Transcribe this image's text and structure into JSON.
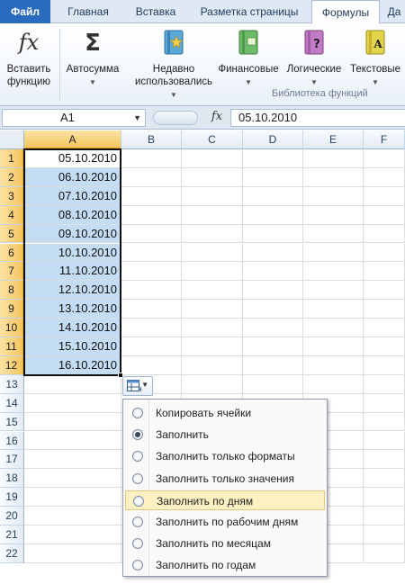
{
  "ribbon_tabs": [
    "Файл",
    "Главная",
    "Вставка",
    "Разметка страницы",
    "Формулы",
    "Да"
  ],
  "active_tab": "Формулы",
  "ribbon": {
    "insert_function": {
      "line1": "Вставить",
      "line2": "функцию",
      "icon": "fx"
    },
    "autosum": {
      "label": "Автосумма",
      "icon": "Σ"
    },
    "recent": {
      "line1": "Недавно",
      "line2": "использовались"
    },
    "financial": {
      "label": "Финансовые"
    },
    "logical": {
      "label": "Логические"
    },
    "text": {
      "label": "Текстовые"
    },
    "group_label": "Библиотека функций"
  },
  "formula_bar": {
    "name_box": "A1",
    "fx_label": "fx",
    "formula": "05.10.2010"
  },
  "columns": [
    "A",
    "B",
    "C",
    "D",
    "E",
    "F"
  ],
  "rows": [
    "1",
    "2",
    "3",
    "4",
    "5",
    "6",
    "7",
    "8",
    "9",
    "10",
    "11",
    "12",
    "13",
    "14",
    "15",
    "16",
    "17",
    "18",
    "19",
    "20",
    "21",
    "22"
  ],
  "column_a_values": [
    "05.10.2010",
    "06.10.2010",
    "07.10.2010",
    "08.10.2010",
    "09.10.2010",
    "10.10.2010",
    "11.10.2010",
    "12.10.2010",
    "13.10.2010",
    "14.10.2010",
    "15.10.2010",
    "16.10.2010"
  ],
  "autofill_menu": {
    "items": [
      {
        "label": "Копировать ячейки",
        "selected": false
      },
      {
        "label": "Заполнить",
        "selected": true
      },
      {
        "label": "Заполнить только форматы",
        "selected": false
      },
      {
        "label": "Заполнить только значения",
        "selected": false
      },
      {
        "label": "Заполнить по дням",
        "selected": false,
        "highlighted": true
      },
      {
        "label": "Заполнить по рабочим дням",
        "selected": false
      },
      {
        "label": "Заполнить по месяцам",
        "selected": false
      },
      {
        "label": "Заполнить по годам",
        "selected": false
      }
    ]
  },
  "colors": {
    "file_tab": "#2a6bbd",
    "selection_fill": "#c5dcf5",
    "header_selected": "#f4c45f",
    "menu_highlight": "#fdf1c3"
  }
}
